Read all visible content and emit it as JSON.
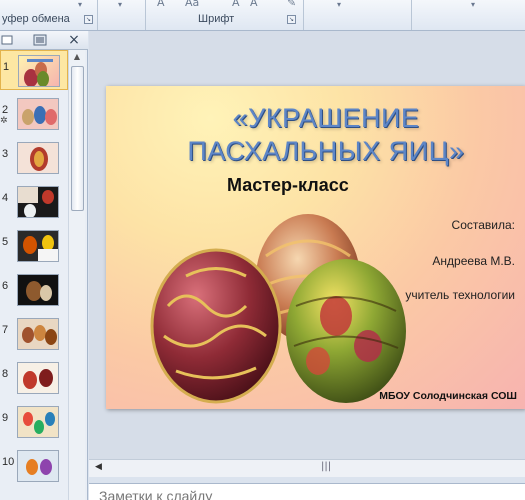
{
  "ribbon": {
    "clipboard_label": "уфер обмена",
    "font_label": "Шрифт",
    "aa_small": "Аа",
    "a_small": "А"
  },
  "panel": {
    "close_glyph": "×",
    "thumbnails": [
      {
        "number": "1"
      },
      {
        "number": "2"
      },
      {
        "number": "3"
      },
      {
        "number": "4"
      },
      {
        "number": "5"
      },
      {
        "number": "6"
      },
      {
        "number": "7"
      },
      {
        "number": "8"
      },
      {
        "number": "9"
      },
      {
        "number": "10"
      }
    ]
  },
  "slide": {
    "title_line1": "«УКРАШЕНИЕ",
    "title_line2": "ПАСХАЛЬНЫХ ЯИЦ»",
    "subtitle": "Мастер-класс",
    "author_label": "Составила:",
    "author_name": "Андреева  М.В.",
    "author_role": "учитель технологии",
    "school": "МБОУ Солодчинская СОШ"
  },
  "notes": {
    "placeholder": "Заметки к слайду"
  },
  "colors": {
    "title": "#5d86c7",
    "selected_thumb": "#fde7a3"
  }
}
